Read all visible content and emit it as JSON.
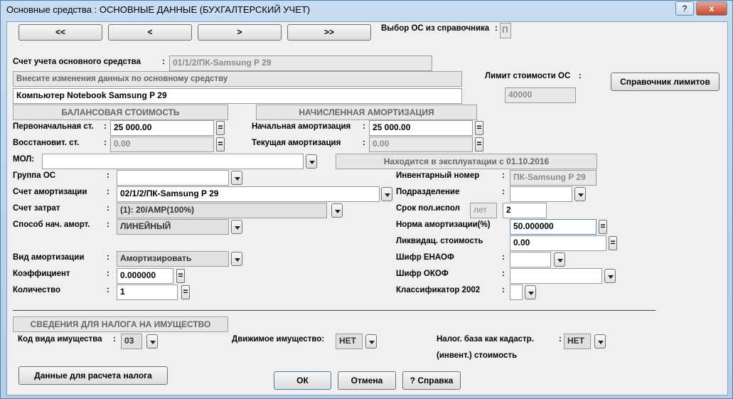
{
  "window": {
    "title": "Основные средства : ОСНОВНЫЕ ДАННЫЕ (БУХГАЛТЕРСКИЙ УЧЕТ)",
    "help_btn": "?",
    "close_btn": "x"
  },
  "nav": {
    "first": "<<",
    "prev": "<",
    "next": ">",
    "last": ">>",
    "select_label": "Выбор ОС из справочника",
    "select_value": "П"
  },
  "colon": ":",
  "account": {
    "label": "Счет учета основного средства",
    "value": "01/1/2/ПК-Samsung P 29"
  },
  "edit_hint": "Внесите изменения данных по основному средству",
  "name_value": "Компьютер Notebook Samsung P 29",
  "limit": {
    "label": "Лимит стоимости ОС",
    "value": "40000",
    "button": "Справочник лимитов"
  },
  "balance": {
    "header": "БАЛАНСОВАЯ СТОИМОСТЬ",
    "initial_label": "Первоначальная ст.",
    "initial_value": "25 000.00",
    "restored_label": "Восстановит.   ст.",
    "restored_value": "0.00"
  },
  "amort": {
    "header": "НАЧИСЛЕННАЯ АМОРТИЗАЦИЯ",
    "initial_label": "Начальная амортизация",
    "initial_value": "25 000.00",
    "current_label": "Текущая     амортизация",
    "current_value": "0.00"
  },
  "equals_symbol": "=",
  "mol_label": "МОЛ:",
  "in_service": "Находится в эксплуатации с 01.10.2016",
  "left": {
    "group_label": "Группа ОС",
    "amort_account_label": "Счет амортизации",
    "amort_account_value": "02/1/2/ПК-Samsung P 29",
    "cost_account_label": "Счет затрат",
    "cost_account_value": "(1): 20/АМР(100%)",
    "method_label": "Способ нач. аморт.",
    "method_value": "ЛИНЕЙНЫЙ",
    "type_label": "Вид амортизации",
    "type_value": "Амортизировать",
    "coef_label": "Коэффициент",
    "coef_value": "0.000000",
    "qty_label": "Количество",
    "qty_value": "1"
  },
  "right": {
    "inv_label": "Инвентарный номер",
    "inv_value": "ПК-Samsung P 29",
    "dept_label": "Подразделение",
    "term_label": "Срок пол.испол",
    "term_unit": "лет",
    "term_value": "2",
    "rate_label": "Норма амортизации(%)",
    "rate_value": "50.000000",
    "liq_label": "Ликвидац. стоимость",
    "liq_value": "0.00",
    "enaof_label": "Шифр ЕНАОФ",
    "okof_label": "Шифр ОКОФ",
    "class_label": "Классификатор 2002"
  },
  "tax": {
    "header": "СВЕДЕНИЯ ДЛЯ НАЛОГА НА ИМУЩЕСТВО",
    "kind_label": "Код вида имущества",
    "kind_value": "03",
    "movable_label": "Движимое имущество:",
    "movable_value": "НЕТ",
    "cadastr_label1": "Налог. база как кадастр.",
    "cadastr_label2": "(инвент.) стоимость",
    "cadastr_value": "НЕТ",
    "calc_button": "Данные для расчета налога"
  },
  "footer": {
    "ok": "ОК",
    "cancel": "Отмена",
    "help": "? Справка"
  }
}
